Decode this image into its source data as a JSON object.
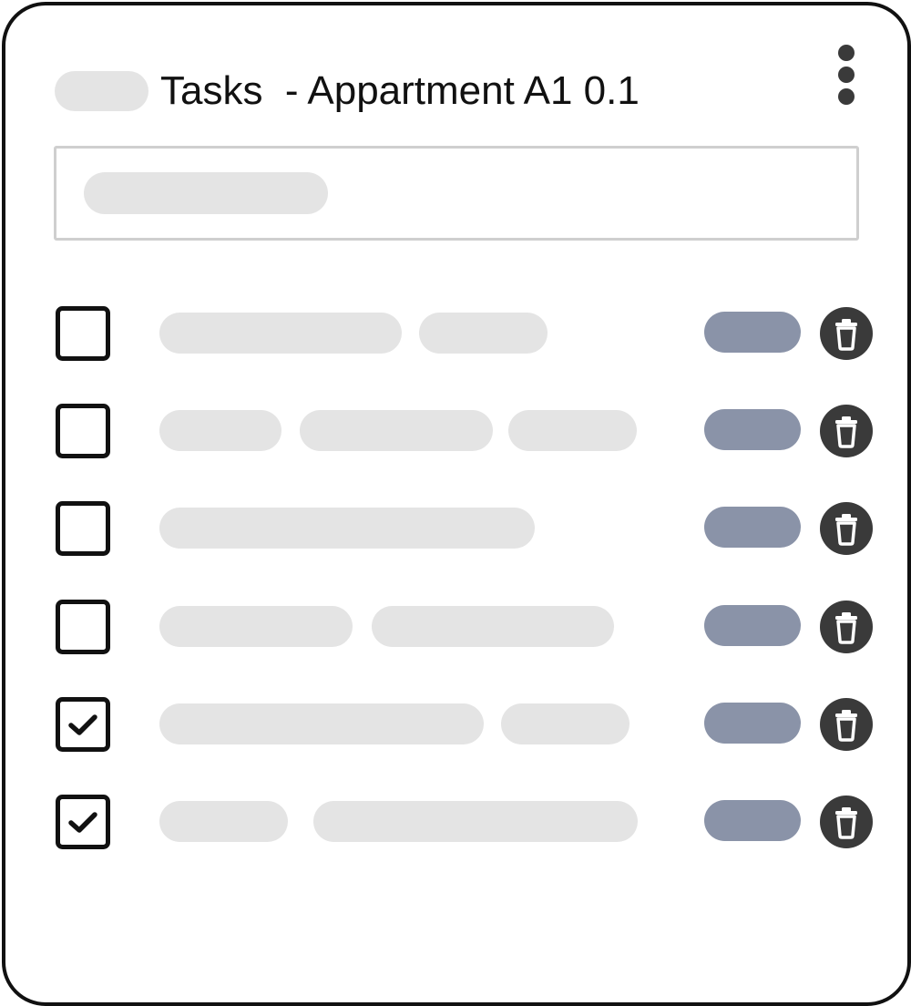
{
  "header": {
    "title": "Tasks  - Appartment A1 0.1"
  },
  "search": {},
  "tasks": [
    {
      "checked": false
    },
    {
      "checked": false
    },
    {
      "checked": false
    },
    {
      "checked": false
    },
    {
      "checked": true
    },
    {
      "checked": true
    }
  ],
  "colors": {
    "border": "#111111",
    "placeholder_pill": "#e4e4e4",
    "tag_pill": "#8a93a8",
    "delete_button": "#3a3a3a",
    "search_border": "#cfcfcf"
  },
  "icons": {
    "menu": "more-vertical-icon",
    "delete": "trash-icon",
    "checkbox_checked": "checkmark-icon"
  }
}
